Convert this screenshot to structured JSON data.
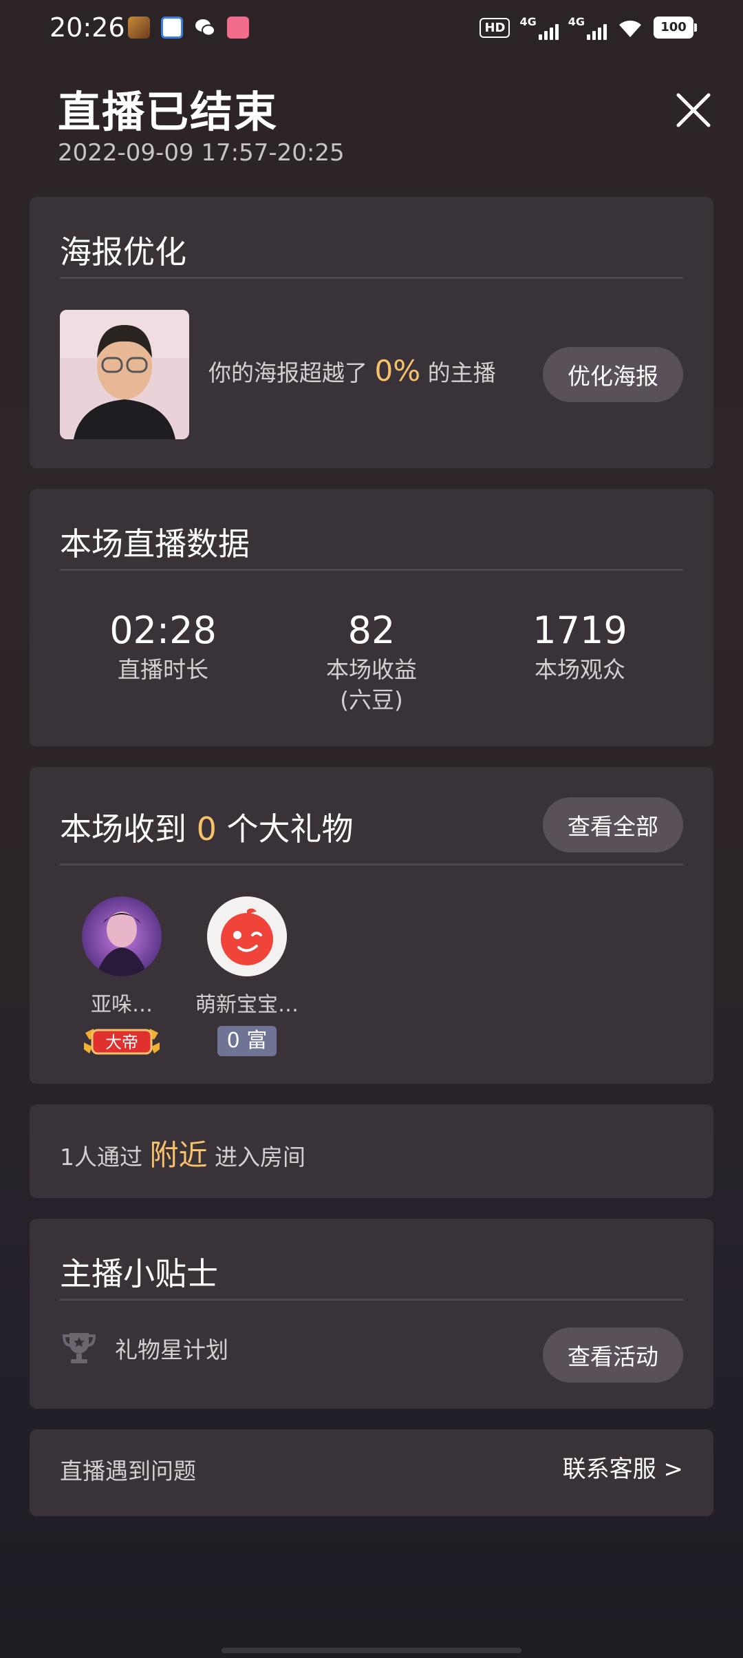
{
  "status_bar": {
    "time": "20:26",
    "hd_label": "HD",
    "network_1": "4G",
    "network_2": "4G",
    "battery": "100"
  },
  "header": {
    "title": "直播已结束",
    "time_range": "2022-09-09 17:57-20:25"
  },
  "poster_card": {
    "title": "海报优化",
    "text_before": "你的海报超越了",
    "percent": "0%",
    "text_after": "的主播",
    "button_label": "优化海报"
  },
  "stats_card": {
    "title": "本场直播数据",
    "stats": [
      {
        "value": "02:28",
        "label": "直播时长"
      },
      {
        "value": "82",
        "label": "本场收益",
        "sub": "(六豆)"
      },
      {
        "value": "1719",
        "label": "本场观众"
      }
    ]
  },
  "gift_card": {
    "title_before": "本场收到",
    "count": "0",
    "title_after": "个大礼物",
    "button_label": "查看全部",
    "users": [
      {
        "name": "亚哚…",
        "badge": "大帝"
      },
      {
        "name": "萌新宝宝…",
        "badge_num": "0",
        "badge": "富"
      }
    ]
  },
  "nearby_card": {
    "text_before": "1人通过",
    "highlight": "附近",
    "text_after": "进入房间"
  },
  "tips_card": {
    "title": "主播小贴士",
    "item_label": "礼物星计划",
    "button_label": "查看活动"
  },
  "issue_card": {
    "label": "直播遇到问题",
    "link": "联系客服 >"
  },
  "colors": {
    "accent": "#f6c36b",
    "card_bg": "#3a3239",
    "pill_bg": "#5a505a"
  }
}
